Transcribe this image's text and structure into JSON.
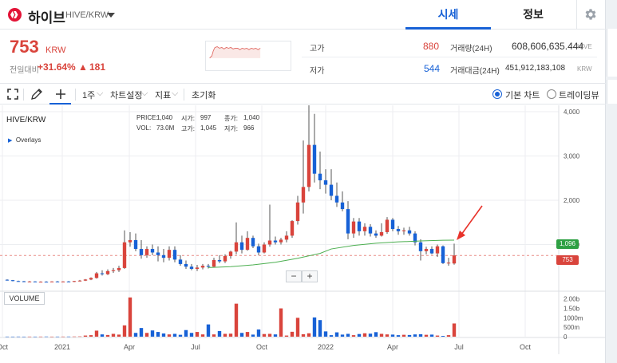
{
  "header": {
    "coin_name": "하이브",
    "pair": "HIVE/KRW",
    "tabs": {
      "quote": "시세",
      "info": "정보"
    }
  },
  "summary": {
    "price": "753",
    "unit": "KRW",
    "change_label": "전일대비",
    "change_pct": "+31.64%",
    "change_arrow": "▲",
    "change_amount": "181",
    "high_label": "고가",
    "high": "880",
    "low_label": "저가",
    "low": "544",
    "volume_label": "거래량(24H)",
    "volume": "608,606,635.444",
    "volume_unit": "HIVE",
    "value_label": "거래대금(24H)",
    "value": "451,912,183,108",
    "value_unit": "KRW"
  },
  "toolbar": {
    "interval": "1주",
    "chart_settings": "차트설정",
    "indicators": "지표",
    "reset": "초기화",
    "basic_chart": "기본 차트",
    "tradingview": "트레이딩뷰"
  },
  "chart_info": {
    "symbol": "HIVE/KRW",
    "overlays": "Overlays",
    "price_label": "PRICE:",
    "price_value": "1,040",
    "open_label": "시가:",
    "open_value": "997",
    "close_label": "종가:",
    "close_value": "1,040",
    "vol_label": "VOL:",
    "vol_value": "73.0M",
    "high_label": "고가:",
    "high_value": "1,045",
    "low_label": "저가:",
    "low_value": "966",
    "volume_button": "VOLUME",
    "zoom_out": "−",
    "zoom_in": "+"
  },
  "chart_data": {
    "type": "candlestick",
    "price_axis": [
      "4,000",
      "3,000",
      "2,000",
      "1,000"
    ],
    "volume_axis": [
      "2.00b",
      "1.50b",
      "1000m",
      "500m",
      "0"
    ],
    "time_axis": [
      "Oct",
      "2021",
      "Apr",
      "Jul",
      "Oct",
      "2022",
      "Apr",
      "Jul",
      "Oct"
    ],
    "ma_tag": "1,096",
    "last_price_tag": "753",
    "ylim": [
      0,
      4000
    ],
    "candles": [
      {
        "t": "2020-10",
        "o": 205,
        "h": 215,
        "l": 185,
        "c": 195
      },
      {
        "t": "2020-10",
        "o": 195,
        "h": 200,
        "l": 170,
        "c": 175
      },
      {
        "t": "2020-11",
        "o": 175,
        "h": 185,
        "l": 160,
        "c": 170
      },
      {
        "t": "2020-11",
        "o": 170,
        "h": 178,
        "l": 150,
        "c": 160
      },
      {
        "t": "2020-11",
        "o": 160,
        "h": 175,
        "l": 150,
        "c": 165
      },
      {
        "t": "2020-11",
        "o": 165,
        "h": 172,
        "l": 150,
        "c": 155
      },
      {
        "t": "2020-12",
        "o": 155,
        "h": 170,
        "l": 145,
        "c": 160
      },
      {
        "t": "2020-12",
        "o": 160,
        "h": 172,
        "l": 150,
        "c": 155
      },
      {
        "t": "2020-12",
        "o": 155,
        "h": 170,
        "l": 150,
        "c": 165
      },
      {
        "t": "2020-12",
        "o": 165,
        "h": 175,
        "l": 150,
        "c": 160
      },
      {
        "t": "2021-01",
        "o": 160,
        "h": 170,
        "l": 150,
        "c": 165
      },
      {
        "t": "2021-01",
        "o": 165,
        "h": 175,
        "l": 155,
        "c": 160
      },
      {
        "t": "2021-01",
        "o": 160,
        "h": 180,
        "l": 150,
        "c": 175
      },
      {
        "t": "2021-01",
        "o": 175,
        "h": 200,
        "l": 165,
        "c": 185
      },
      {
        "t": "2021-02",
        "o": 185,
        "h": 220,
        "l": 175,
        "c": 210
      },
      {
        "t": "2021-02",
        "o": 210,
        "h": 260,
        "l": 195,
        "c": 245
      },
      {
        "t": "2021-02",
        "o": 245,
        "h": 380,
        "l": 230,
        "c": 350
      },
      {
        "t": "2021-02",
        "o": 350,
        "h": 420,
        "l": 300,
        "c": 330
      },
      {
        "t": "2021-03",
        "o": 330,
        "h": 440,
        "l": 310,
        "c": 400
      },
      {
        "t": "2021-03",
        "o": 400,
        "h": 470,
        "l": 360,
        "c": 420
      },
      {
        "t": "2021-03",
        "o": 420,
        "h": 520,
        "l": 380,
        "c": 470
      },
      {
        "t": "2021-03",
        "o": 470,
        "h": 1320,
        "l": 450,
        "c": 1050
      },
      {
        "t": "2021-04",
        "o": 1050,
        "h": 1280,
        "l": 950,
        "c": 1100
      },
      {
        "t": "2021-04",
        "o": 1100,
        "h": 1250,
        "l": 850,
        "c": 900
      },
      {
        "t": "2021-04",
        "o": 900,
        "h": 1100,
        "l": 680,
        "c": 760
      },
      {
        "t": "2021-04",
        "o": 760,
        "h": 960,
        "l": 700,
        "c": 900
      },
      {
        "t": "2021-05",
        "o": 900,
        "h": 1000,
        "l": 760,
        "c": 820
      },
      {
        "t": "2021-05",
        "o": 820,
        "h": 960,
        "l": 620,
        "c": 760
      },
      {
        "t": "2021-05",
        "o": 760,
        "h": 900,
        "l": 600,
        "c": 700
      },
      {
        "t": "2021-05",
        "o": 700,
        "h": 960,
        "l": 640,
        "c": 880
      },
      {
        "t": "2021-06",
        "o": 880,
        "h": 960,
        "l": 600,
        "c": 660
      },
      {
        "t": "2021-06",
        "o": 660,
        "h": 760,
        "l": 520,
        "c": 560
      },
      {
        "t": "2021-06",
        "o": 560,
        "h": 640,
        "l": 450,
        "c": 500
      },
      {
        "t": "2021-06",
        "o": 500,
        "h": 560,
        "l": 420,
        "c": 450
      },
      {
        "t": "2021-07",
        "o": 450,
        "h": 540,
        "l": 400,
        "c": 480
      },
      {
        "t": "2021-07",
        "o": 480,
        "h": 560,
        "l": 440,
        "c": 520
      },
      {
        "t": "2021-07",
        "o": 520,
        "h": 560,
        "l": 460,
        "c": 500
      },
      {
        "t": "2021-07",
        "o": 500,
        "h": 700,
        "l": 480,
        "c": 650
      },
      {
        "t": "2021-08",
        "o": 650,
        "h": 760,
        "l": 580,
        "c": 620
      },
      {
        "t": "2021-08",
        "o": 620,
        "h": 780,
        "l": 580,
        "c": 740
      },
      {
        "t": "2021-08",
        "o": 740,
        "h": 860,
        "l": 680,
        "c": 840
      },
      {
        "t": "2021-08",
        "o": 840,
        "h": 1500,
        "l": 780,
        "c": 1050
      },
      {
        "t": "2021-09",
        "o": 1050,
        "h": 1200,
        "l": 800,
        "c": 880
      },
      {
        "t": "2021-09",
        "o": 880,
        "h": 1300,
        "l": 860,
        "c": 1150
      },
      {
        "t": "2021-09",
        "o": 1150,
        "h": 1200,
        "l": 920,
        "c": 960
      },
      {
        "t": "2021-09",
        "o": 960,
        "h": 1020,
        "l": 760,
        "c": 820
      },
      {
        "t": "2021-10",
        "o": 820,
        "h": 1050,
        "l": 800,
        "c": 1000
      },
      {
        "t": "2021-10",
        "o": 1000,
        "h": 1900,
        "l": 950,
        "c": 1090
      },
      {
        "t": "2021-10",
        "o": 1090,
        "h": 1180,
        "l": 1000,
        "c": 1050
      },
      {
        "t": "2021-10",
        "o": 1050,
        "h": 1150,
        "l": 1000,
        "c": 1110
      },
      {
        "t": "2021-11",
        "o": 1110,
        "h": 1300,
        "l": 1050,
        "c": 1200
      },
      {
        "t": "2021-11",
        "o": 1200,
        "h": 1550,
        "l": 1150,
        "c": 1530
      },
      {
        "t": "2021-11",
        "o": 1530,
        "h": 2100,
        "l": 1450,
        "c": 1950
      },
      {
        "t": "2021-11",
        "o": 1950,
        "h": 3350,
        "l": 1700,
        "c": 2300
      },
      {
        "t": "2021-12",
        "o": 2300,
        "h": 4200,
        "l": 2200,
        "c": 3250
      },
      {
        "t": "2021-12",
        "o": 3250,
        "h": 3950,
        "l": 2400,
        "c": 2600
      },
      {
        "t": "2021-12",
        "o": 2600,
        "h": 3100,
        "l": 2250,
        "c": 2450
      },
      {
        "t": "2021-12",
        "o": 2450,
        "h": 2700,
        "l": 2150,
        "c": 2350
      },
      {
        "t": "2022-01",
        "o": 2350,
        "h": 2700,
        "l": 2000,
        "c": 2100
      },
      {
        "t": "2022-01",
        "o": 2100,
        "h": 2400,
        "l": 1850,
        "c": 1950
      },
      {
        "t": "2022-01",
        "o": 1950,
        "h": 2200,
        "l": 1750,
        "c": 1800
      },
      {
        "t": "2022-01",
        "o": 1800,
        "h": 1980,
        "l": 1120,
        "c": 1250
      },
      {
        "t": "2022-02",
        "o": 1250,
        "h": 1600,
        "l": 1150,
        "c": 1520
      },
      {
        "t": "2022-02",
        "o": 1520,
        "h": 1600,
        "l": 1200,
        "c": 1300
      },
      {
        "t": "2022-02",
        "o": 1300,
        "h": 1480,
        "l": 1200,
        "c": 1400
      },
      {
        "t": "2022-02",
        "o": 1400,
        "h": 1460,
        "l": 1180,
        "c": 1250
      },
      {
        "t": "2022-03",
        "o": 1250,
        "h": 1320,
        "l": 1150,
        "c": 1200
      },
      {
        "t": "2022-03",
        "o": 1200,
        "h": 1480,
        "l": 1180,
        "c": 1280
      },
      {
        "t": "2022-03",
        "o": 1280,
        "h": 1620,
        "l": 1240,
        "c": 1560
      },
      {
        "t": "2022-03",
        "o": 1560,
        "h": 1600,
        "l": 1300,
        "c": 1350
      },
      {
        "t": "2022-04",
        "o": 1350,
        "h": 1420,
        "l": 1220,
        "c": 1300
      },
      {
        "t": "2022-04",
        "o": 1300,
        "h": 1380,
        "l": 1220,
        "c": 1320
      },
      {
        "t": "2022-04",
        "o": 1320,
        "h": 1400,
        "l": 1200,
        "c": 1250
      },
      {
        "t": "2022-04",
        "o": 1250,
        "h": 1300,
        "l": 980,
        "c": 1050
      },
      {
        "t": "2022-05",
        "o": 1050,
        "h": 1120,
        "l": 640,
        "c": 850
      },
      {
        "t": "2022-05",
        "o": 850,
        "h": 950,
        "l": 780,
        "c": 900
      },
      {
        "t": "2022-05",
        "o": 900,
        "h": 960,
        "l": 780,
        "c": 800
      },
      {
        "t": "2022-05",
        "o": 800,
        "h": 1000,
        "l": 720,
        "c": 960
      },
      {
        "t": "2022-06",
        "o": 960,
        "h": 980,
        "l": 560,
        "c": 580
      },
      {
        "t": "2022-06",
        "o": 580,
        "h": 700,
        "l": 520,
        "c": 590
      },
      {
        "t": "2022-06",
        "o": 572,
        "h": 1020,
        "l": 544,
        "c": 753
      }
    ],
    "ma": [
      [
        36,
        480
      ],
      [
        40,
        500
      ],
      [
        44,
        540
      ],
      [
        48,
        600
      ],
      [
        52,
        690
      ],
      [
        56,
        800
      ],
      [
        58,
        900
      ],
      [
        62,
        980
      ],
      [
        66,
        1030
      ],
      [
        70,
        1060
      ],
      [
        74,
        1080
      ],
      [
        78,
        1096
      ],
      [
        80,
        1100
      ]
    ],
    "volumes_m": [
      5,
      4,
      6,
      3,
      5,
      4,
      6,
      8,
      4,
      5,
      6,
      7,
      10,
      15,
      60,
      80,
      320,
      120,
      90,
      150,
      110,
      600,
      2080,
      200,
      460,
      200,
      330,
      250,
      170,
      120,
      150,
      100,
      350,
      200,
      250,
      120,
      650,
      120,
      300,
      150,
      160,
      1750,
      200,
      250,
      110,
      380,
      140,
      150,
      120,
      1500,
      60,
      260,
      1000,
      130,
      180,
      1020,
      880,
      280,
      80,
      230,
      110,
      150,
      80,
      140,
      180,
      160,
      240,
      150,
      120,
      110,
      80,
      100,
      90,
      120,
      130,
      100,
      110,
      60,
      40,
      80,
      700
    ]
  }
}
